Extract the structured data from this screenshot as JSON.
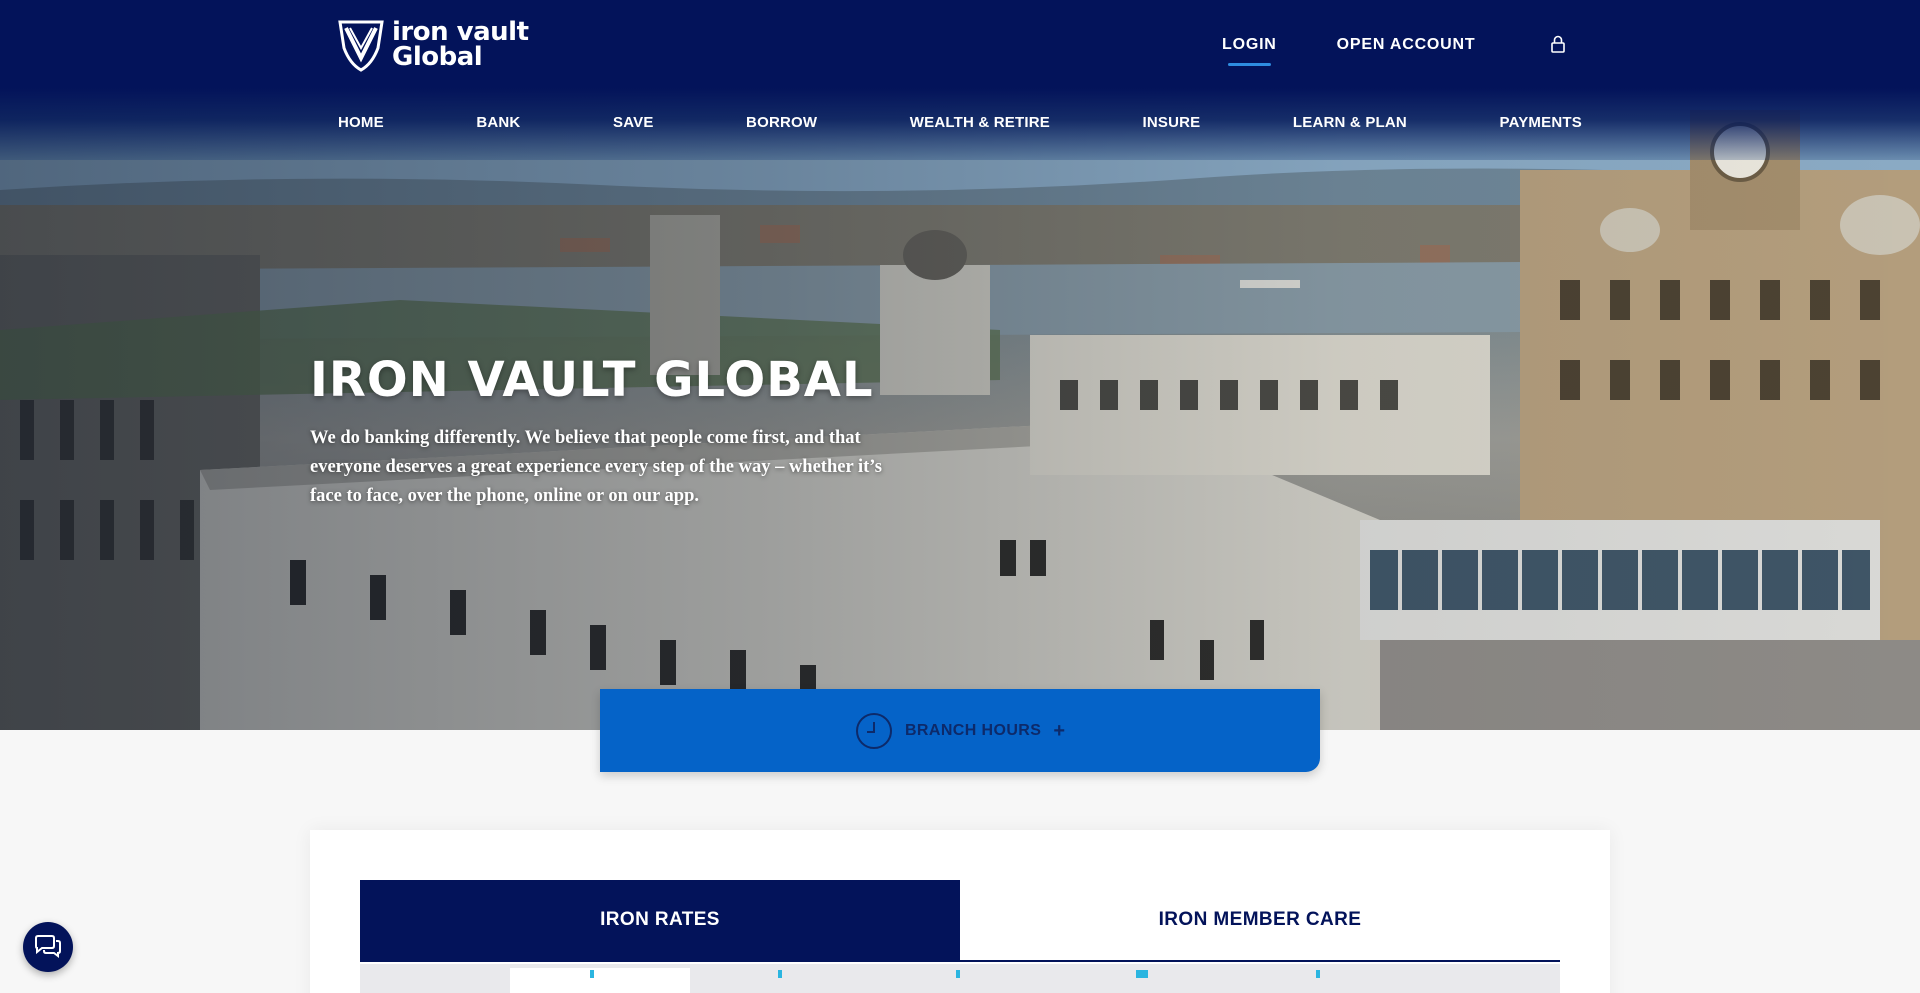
{
  "brand": {
    "name_line1": "iron vault",
    "name_line2": "Global",
    "colors": {
      "navy": "#03135a",
      "blue": "#0563c8",
      "accent": "#2e8de0"
    }
  },
  "header": {
    "login_label": "LOGIN",
    "open_account_label": "OPEN ACCOUNT",
    "lock_icon": "lock-icon"
  },
  "nav": {
    "items": [
      {
        "label": "HOME"
      },
      {
        "label": "BANK"
      },
      {
        "label": "SAVE"
      },
      {
        "label": "BORROW"
      },
      {
        "label": "WEALTH & RETIRE"
      },
      {
        "label": "INSURE"
      },
      {
        "label": "LEARN & PLAN"
      },
      {
        "label": "PAYMENTS"
      }
    ]
  },
  "hero": {
    "title": "IRON VAULT GLOBAL",
    "text": "We do banking differently. We believe that people come first, and that everyone deserves a great experience every step of the way – whether it’s face to face, over the phone, online or on our app."
  },
  "branch_hours": {
    "label": "BRANCH HOURS",
    "toggle": "+",
    "icon": "clock-icon"
  },
  "tabs": {
    "items": [
      {
        "label": "IRON RATES",
        "active": true
      },
      {
        "label": "IRON MEMBER CARE",
        "active": false
      }
    ]
  },
  "chat": {
    "icon": "chat-icon"
  }
}
